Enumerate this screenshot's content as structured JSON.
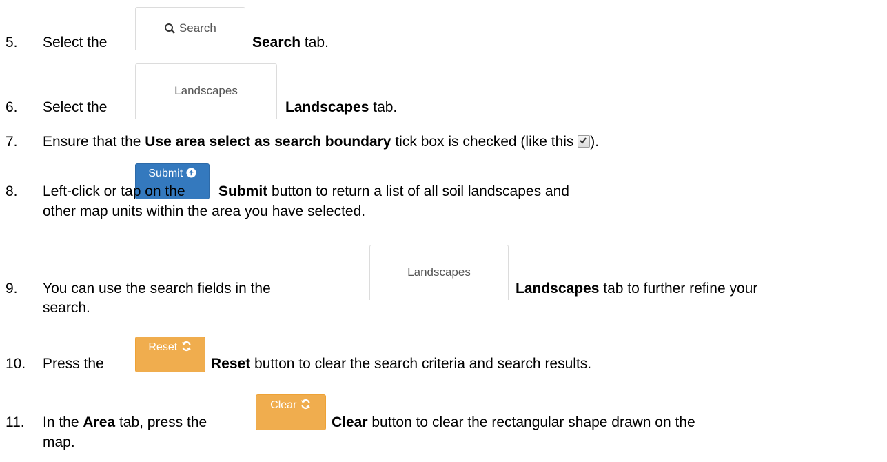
{
  "steps": [
    {
      "num": "5.",
      "pre": "Select the",
      "bold": "Search",
      "post": "tab.",
      "ui_label": "Search"
    },
    {
      "num": "6.",
      "pre": "Select the",
      "bold": "Landscapes",
      "post": "tab.",
      "ui_label": "Landscapes"
    },
    {
      "num": "7.",
      "pre": "Ensure that the",
      "bold": "Use area select as search boundary",
      "post": "tick box is checked (like this",
      "post2": ")."
    },
    {
      "num": "8.",
      "pre": "Left-click or tap on the",
      "bold": "Submit",
      "post": "button to return a list of all soil landscapes and",
      "line2": "other map units within the area you have selected.",
      "ui_label": "Submit"
    },
    {
      "num": "9.",
      "pre": "You can use the search fields in the",
      "bold": "Landscapes",
      "post": "tab to further refine your",
      "line2": "search.",
      "ui_label": "Landscapes"
    },
    {
      "num": "10.",
      "pre": "Press the",
      "bold": "Reset",
      "post": "button to clear the search criteria and search results.",
      "ui_label": "Reset"
    },
    {
      "num": "11.",
      "pre": "In the",
      "bold1": "Area",
      "mid": "tab, press the",
      "bold": "Clear",
      "post": "button to clear the rectangular shape drawn on the",
      "line2": "map.",
      "ui_label": "Clear"
    }
  ],
  "colors": {
    "submit": "#3479be",
    "reset": "#f0ad4e",
    "clear": "#f0ad4e",
    "tab_border": "#dcdcdc"
  }
}
